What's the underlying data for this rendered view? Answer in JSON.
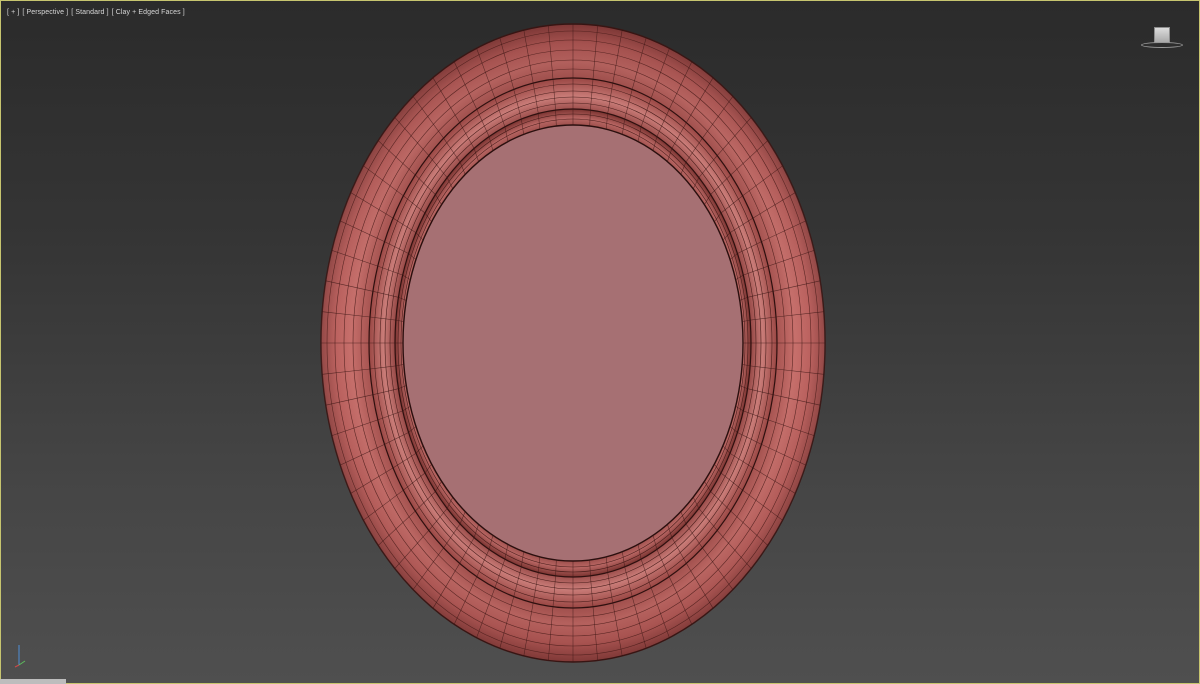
{
  "viewport": {
    "label_plus": "[ + ]",
    "label_view": "[ Perspective ]",
    "label_shading": "[ Standard ]",
    "label_mode": "[ Clay + Edged Faces ]"
  },
  "icons": {
    "viewcube": "viewcube-icon",
    "axis": "axis-tripod-icon"
  },
  "colors": {
    "frame_base": "#b55856",
    "frame_highlight": "#d58a86",
    "frame_dark": "#8e3f3d",
    "inner_panel": "#a67073",
    "wire": "#3a1614",
    "border_active": "#c7c56f"
  }
}
